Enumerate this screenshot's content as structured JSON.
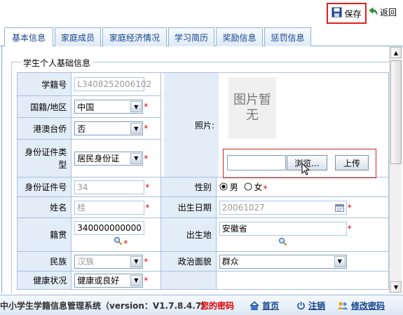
{
  "toolbar": {
    "save_label": "保存",
    "back_label": "返回"
  },
  "tabs": [
    {
      "label": "基本信息",
      "active": true
    },
    {
      "label": "家庭成员"
    },
    {
      "label": "家庭经济情况"
    },
    {
      "label": "学习简历"
    },
    {
      "label": "奖励信息"
    },
    {
      "label": "惩罚信息"
    }
  ],
  "section": {
    "legend": "学生个人基础信息"
  },
  "form": {
    "student_no_label": "学籍号",
    "student_no_value": "L3408252006102",
    "nationality_label": "国籍/地区",
    "nationality_value": "中国",
    "hkmt_label": "港澳台侨",
    "hkmt_value": "否",
    "id_type_label": "身份证件类型",
    "id_type_value": "居民身份证",
    "id_no_label": "身份证件号",
    "id_no_value": "34",
    "name_label": "姓名",
    "name_value": "桂",
    "native_label": "籍贯",
    "native_value": "340000000000",
    "ethnic_label": "民族",
    "ethnic_value": "汉族",
    "health_label": "健康状况",
    "health_value": "健康或良好",
    "photo_label": "照片:",
    "photo_placeholder": "图片暂无",
    "browse_label": "浏览...",
    "upload_label": "上传",
    "gender_label": "性别",
    "gender_male": "男",
    "gender_female": "女",
    "gender_selected": "男",
    "birth_label": "出生日期",
    "birth_value": "20061027",
    "birthplace_label": "出生地",
    "birthplace_value": "安徽省",
    "political_label": "政治面貌",
    "political_value": "群众",
    "required_mark": "*"
  },
  "footer": {
    "system_name": "中小学生学籍信息管理系统（version：V1.7.8.4.7）",
    "password_notice": "您的密码",
    "home_label": "首页",
    "logout_label": "注销",
    "change_pwd_label": "修改密码"
  },
  "colors": {
    "accent": "#15428b",
    "required": "#e00000",
    "label_bg": "#e3edf8",
    "highlight": "#e02020"
  }
}
